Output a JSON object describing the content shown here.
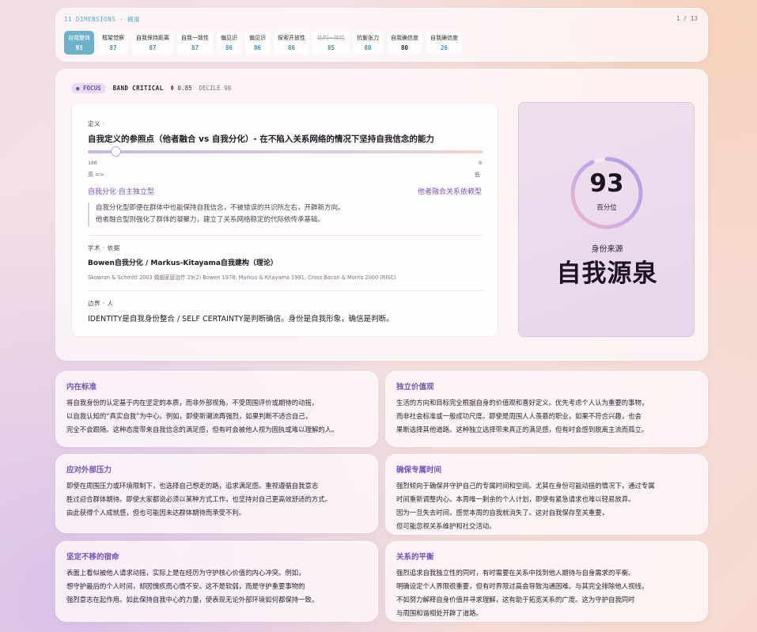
{
  "dimensions": {
    "title": "11 DIMENSIONS · 概度",
    "page": "1 / 13",
    "chips": [
      {
        "label": "自我整体",
        "value": "93"
      },
      {
        "label": "框架觉察",
        "value": "87"
      },
      {
        "label": "自我保持距离",
        "value": "87"
      },
      {
        "label": "自我一致性",
        "value": "87"
      },
      {
        "label": "偏见识",
        "value": "86"
      },
      {
        "label": "偏见识",
        "value": "86"
      },
      {
        "label": "探索开放性",
        "value": "86"
      },
      {
        "label": "结构一致性",
        "value": "85"
      },
      {
        "label": "抗衡张力",
        "value": "80"
      },
      {
        "label": "自我确信度",
        "value": "80"
      },
      {
        "label": "自我确信度",
        "value": "26"
      }
    ]
  },
  "main": {
    "tags": {
      "focus": "● FOCUS",
      "band": "BAND CRITICAL",
      "score": "Φ 0.85",
      "decile": "DECILE 98"
    },
    "definition": {
      "label": "定义 ·",
      "text": "自我定义的参照点（他者融合 vs 自我分化）- 在不陷入关系网络的情况下坚持自我信念的能力",
      "slider_min": "100",
      "slider_max": "0",
      "slider_value": 0.07,
      "pole_high": "高 =>",
      "pole_low": "低·",
      "type_left": "自我分化·自主独立型",
      "type_right": "他者融合关系依赖型",
      "quote_1": "自我分化型即便在群体中也能保持自我信念，不被错误的共识所左右，开辟新方向。",
      "quote_2": "他者融合型则强化了群体的凝聚力，建立了关系网络稳定的代际依传承基础。"
    },
    "basis": {
      "label": "学术 · 依据",
      "title": "Bowen自我分化 / Markus-Kitayama自我建构（理论）",
      "refs": "Skowran & Schmitt 2003 婚姻家庭治疗 29(2) Bowen 1978; Markus & Kitayama 1991; Cross Bacon & Morris 2000 (RISC)"
    },
    "boundary": {
      "label": "边界 · 人",
      "text": "IDENTITY是自我身份整合 / SELF CERTAINTY是判断确信。身份是自我形象，确信是判断。"
    },
    "score": {
      "value": "93",
      "value_fraction": 0.93,
      "unit": "百分位",
      "source_label": "身份来源",
      "source_name": "自我源泉"
    }
  },
  "facets": [
    {
      "title": "内在标准",
      "lines": [
        "将自我身份的认定基于内在坚定的本质，而非外部视角。不受周围评价或期待的动摇，",
        "以自我认知的“真实自我”为中心。例如，即使新潮流再强烈，如果判断不适合自己，",
        "完全不会跟随。这种态度带来自我信念的满足感，但有时会被他人视为固执或难以理解的人。"
      ]
    },
    {
      "title": "独立价值观",
      "lines": [
        "生活的方向和目标完全根据自身的价值观和喜好定义。优先考虑个人认为重要的事物，",
        "而非社会标准或一般成功尺度。即使是周围人人羡慕的职业，如果不符合兴趣，也会",
        "果断选择其他道路。这种独立选择带来真正的满足感，但有时会感到脱离主流而孤立。"
      ]
    },
    {
      "title": "应对外部压力",
      "lines": [
        "即使在周围压力或环境限制下，也选择自己想走的路，追求满足感。重视遵循自我意志",
        "胜过迎合群体期待。即使大家都说必须以某种方式工作，也坚持对自己更高效舒适的方式。",
        "由此获得个人成就感，但也可能因未达群体期待而承受不利。"
      ]
    },
    {
      "title": "确保专属时间",
      "lines": [
        "强烈倾向于确保并守护自己的专属时间和空间。尤其在身份可能动摇的情况下，通过专属",
        "时间重新调整内心。本周唯一剩余的个人计划，即使有紧急请求也难以轻易放弃。",
        "因为一旦失去时间，感觉本周的自我就消失了。这对自我保存至关重要，",
        "但可能忽视关系维护和社交活动。"
      ]
    },
    {
      "title": "坚定不移的宿命",
      "lines": [
        "表面上看似被他人请求动摇，实际上是在经历为守护核心价值的内心冲突。例如，",
        "想守护最后的个人时间，却因愧疚而心情不安。这不是软弱，而是守护重要事物的",
        "强烈意志在起作用。如此保持自我中心的力量，使表现无论外部环境如何都保持一致。"
      ]
    },
    {
      "title": "关系的平衡",
      "lines": [
        "强烈追求自我独立性的同时，有时需要在关系中找到他人期待与自身需求的平衡。",
        "明确设定个人界限很重要，但有时界限过高会导致沟通困难。与其完全排除他人视线，",
        "不如努力解释自身价值并寻求理解，这有助于拓宽关系的广度。这为守护自我同时",
        "与周围和谐相处开辟了道路。"
      ]
    }
  ]
}
